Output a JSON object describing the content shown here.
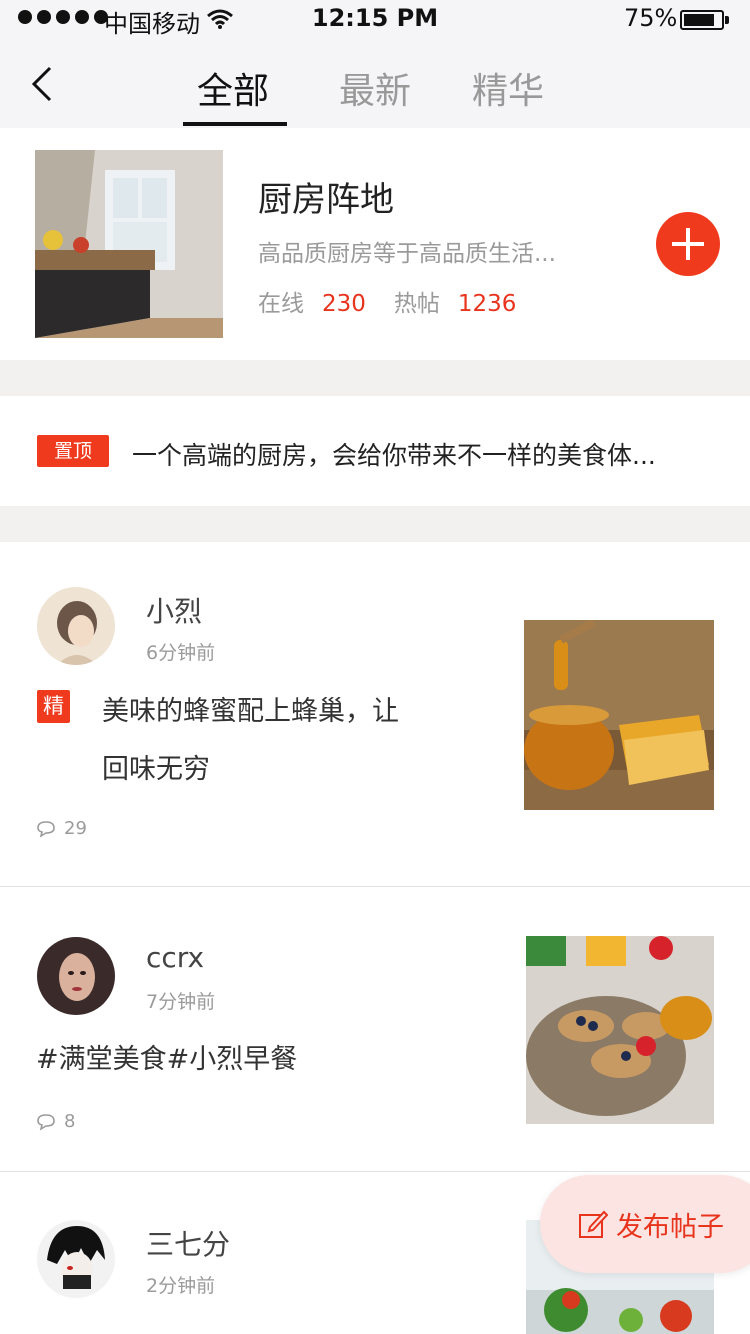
{
  "status": {
    "carrier": "中国移动",
    "time": "12:15 PM",
    "battery": "75%"
  },
  "nav": {
    "tabs": [
      {
        "label": "全部",
        "active": true
      },
      {
        "label": "最新",
        "active": false
      },
      {
        "label": "精华",
        "active": false
      }
    ]
  },
  "community": {
    "title": "厨房阵地",
    "desc": "高品质厨房等于高品质生活...",
    "online_label": "在线",
    "online_count": "230",
    "hot_label": "热帖",
    "hot_count": "1236"
  },
  "pinned": {
    "badge": "置顶",
    "text": "一个高端的厨房，会给你带来不一样的美食体..."
  },
  "posts": [
    {
      "user": "小烈",
      "time": "6分钟前",
      "badge": "精",
      "text_line1": "美味的蜂蜜配上蜂巢，让",
      "text_line2": "回味无穷",
      "comments": "29"
    },
    {
      "user": "ccrx",
      "time": "7分钟前",
      "text": "#满堂美食#小烈早餐",
      "comments": "8"
    },
    {
      "user": "三七分",
      "time": "2分钟前"
    }
  ],
  "publish_button": {
    "label": "发布帖子",
    "color": "#e8341d"
  },
  "colors": {
    "accent": "#f03a1e",
    "number_red": "#e8341d"
  },
  "icons": [
    "back-icon",
    "plus-icon",
    "comment-icon",
    "edit-icon",
    "wifi-icon"
  ]
}
